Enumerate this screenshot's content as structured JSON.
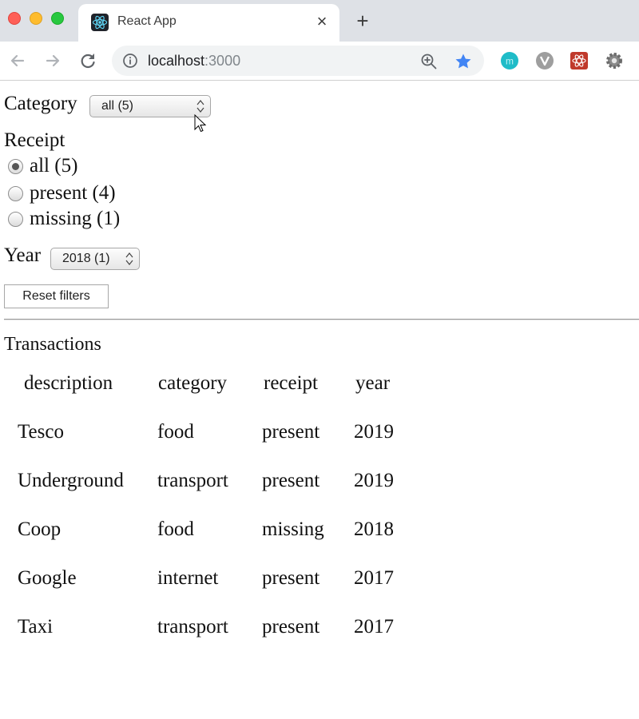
{
  "browser": {
    "tab_title": "React App",
    "tab_close": "×",
    "new_tab": "+",
    "url_host": "localhost",
    "url_port": ":3000"
  },
  "filters": {
    "category": {
      "label": "Category",
      "selected": "all (5)"
    },
    "receipt": {
      "label": "Receipt",
      "options": [
        {
          "label": "all (5)",
          "checked": true
        },
        {
          "label": "present (4)",
          "checked": false
        },
        {
          "label": "missing (1)",
          "checked": false
        }
      ]
    },
    "year": {
      "label": "Year",
      "selected": "2018 (1)"
    },
    "reset_label": "Reset filters"
  },
  "transactions": {
    "title": "Transactions",
    "columns": [
      "description",
      "category",
      "receipt",
      "year"
    ],
    "rows": [
      [
        "Tesco",
        "food",
        "present",
        "2019"
      ],
      [
        "Underground",
        "transport",
        "present",
        "2019"
      ],
      [
        "Coop",
        "food",
        "missing",
        "2018"
      ],
      [
        "Google",
        "internet",
        "present",
        "2017"
      ],
      [
        "Taxi",
        "transport",
        "present",
        "2017"
      ]
    ]
  },
  "colors": {
    "accent_star": "#4285f4",
    "ext_m": "#1fbcc8",
    "ext_v": "#9e9e9e",
    "ext_r": "#c0392b",
    "ext_g": "#8a8a8a"
  }
}
